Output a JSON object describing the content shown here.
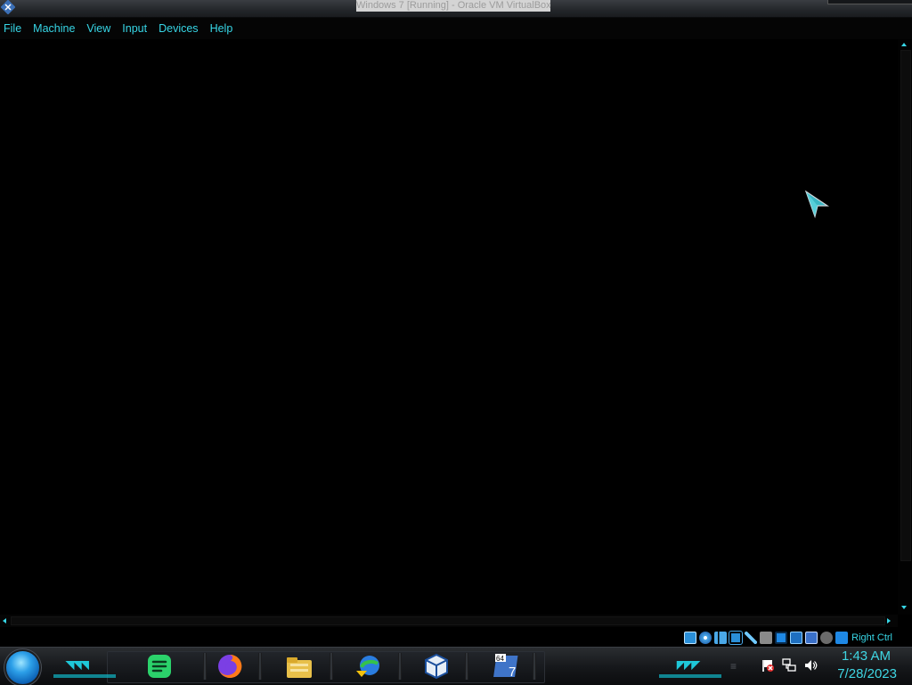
{
  "window": {
    "title": "Windows 7 [Running] - Oracle VM VirtualBox"
  },
  "menubar": {
    "items": [
      "File",
      "Machine",
      "View",
      "Input",
      "Devices",
      "Help"
    ]
  },
  "statusbar": {
    "icons": [
      "hard-disk-icon",
      "optical-drive-icon",
      "audio-icon",
      "network-icon",
      "usb-icon",
      "shared-folders-icon",
      "display-icon",
      "recording-icon",
      "vt-x-icon",
      "mouse-integration-icon",
      "keyboard-capture-icon"
    ],
    "host_key": "Right Ctrl"
  },
  "taskbar": {
    "apps": [
      "notes-app-icon",
      "firefox-icon",
      "file-explorer-icon",
      "internet-download-manager-icon",
      "virtualbox-icon",
      "windows-7-x64-vm-icon"
    ],
    "tray_icons": [
      "action-center-flag-icon",
      "network-tray-icon",
      "volume-icon"
    ],
    "clock_time": "1:43 AM",
    "clock_date": "7/28/2023"
  },
  "colors": {
    "accent": "#37d6e6",
    "background": "#000000"
  }
}
